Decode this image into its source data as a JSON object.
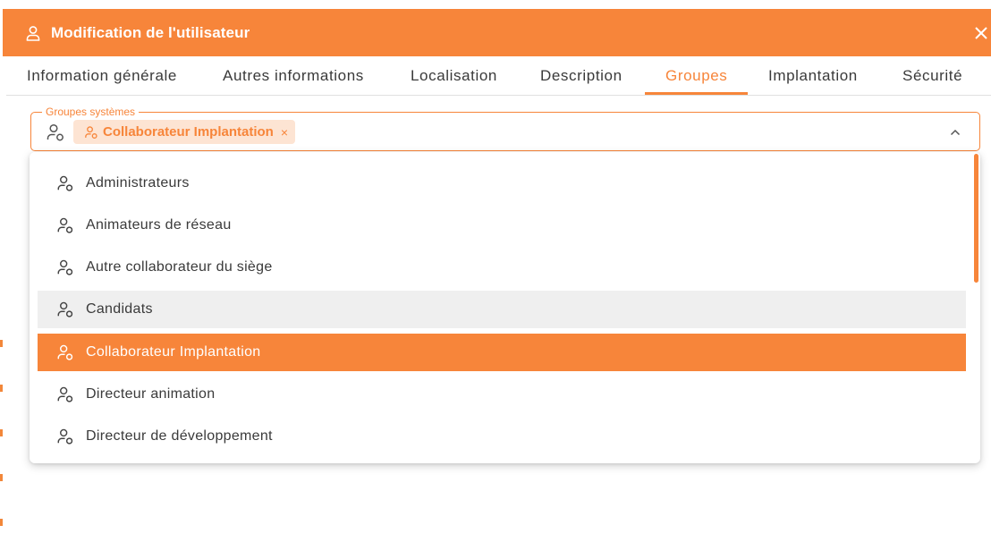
{
  "dialog": {
    "title": "Modification de l'utilisateur",
    "accent_color": "#f7853a"
  },
  "tabs": [
    {
      "label": "Information générale"
    },
    {
      "label": "Autres informations"
    },
    {
      "label": "Localisation"
    },
    {
      "label": "Description"
    },
    {
      "label": "Groupes",
      "active": true
    },
    {
      "label": "Implantation"
    },
    {
      "label": "Sécurité"
    }
  ],
  "groups_field": {
    "label": "Groupes systèmes",
    "selected_chip": "Collaborateur Implantation",
    "chip_remove": "×"
  },
  "options": [
    {
      "label": "Administrateurs",
      "state": "normal"
    },
    {
      "label": "Animateurs de réseau",
      "state": "normal"
    },
    {
      "label": "Autre collaborateur du siège",
      "state": "normal"
    },
    {
      "label": "Candidats",
      "state": "hover"
    },
    {
      "label": "Collaborateur Implantation",
      "state": "selected"
    },
    {
      "label": "Directeur animation",
      "state": "normal"
    },
    {
      "label": "Directeur de développement",
      "state": "normal"
    }
  ],
  "icons": {
    "header": "user-icon",
    "close": "close-icon",
    "field": "user-group-icon",
    "chevron": "chevron-up-icon"
  }
}
